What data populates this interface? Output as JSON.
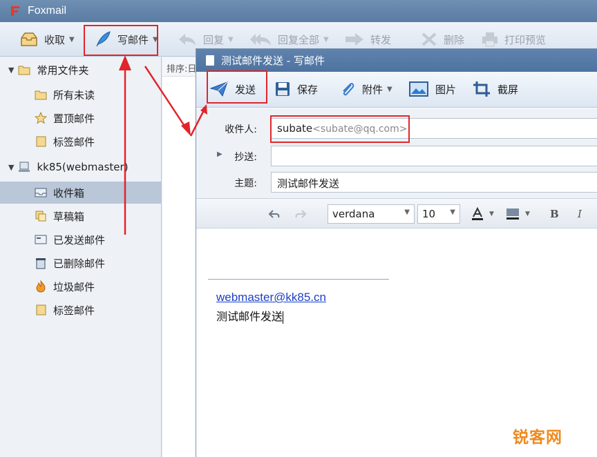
{
  "app": {
    "title": "Foxmail"
  },
  "toolbar": {
    "receive": "收取",
    "compose": "写邮件",
    "reply": "回复",
    "reply_all": "回复全部",
    "forward": "转发",
    "delete": "删除",
    "print_preview": "打印预览"
  },
  "sidebar": {
    "common_folder": "常用文件夹",
    "all_unread": "所有未读",
    "pinned": "置顶邮件",
    "tagged": "标签邮件",
    "account": "kk85(webmaster)",
    "inbox": "收件箱",
    "drafts": "草稿箱",
    "sent": "已发送邮件",
    "deleted": "已删除邮件",
    "junk": "垃圾邮件",
    "tagged2": "标签邮件"
  },
  "list": {
    "sort_label": "排序:日"
  },
  "compose": {
    "title": "测试邮件发送 - 写邮件",
    "toolbar": {
      "send": "发送",
      "save": "保存",
      "attach": "附件",
      "image": "图片",
      "screenshot": "截屏"
    },
    "to_label": "收件人:",
    "to_name": "subate",
    "to_email": "<subate@qq.com>",
    "cc_label": "抄送:",
    "cc_value": "",
    "subject_label": "主题:",
    "subject_value": "测试邮件发送",
    "font_family": "verdana",
    "font_size": "10",
    "signature_link": "webmaster@kk85.cn",
    "body_text": "测试邮件发送"
  },
  "watermark": "锐客网",
  "colors": {
    "highlight": "#e0252b",
    "link": "#1a3fc7",
    "watermark": "#f08a1c"
  }
}
